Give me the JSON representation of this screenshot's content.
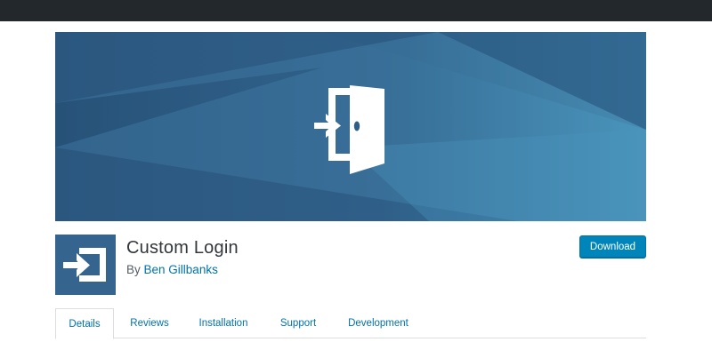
{
  "colors": {
    "topbar": "#23282d",
    "banner_dark": "#2e5c85",
    "banner_light": "#52a3c7",
    "accent": "#0085ba",
    "link": "#0073aa",
    "icon_bg": "#35658f"
  },
  "banner": {
    "icon": "door-enter-icon"
  },
  "plugin": {
    "icon": "login-arrow-icon",
    "title": "Custom Login",
    "by_prefix": "By",
    "author": "Ben Gillbanks"
  },
  "actions": {
    "download_label": "Download"
  },
  "tabs": [
    {
      "label": "Details",
      "active": true
    },
    {
      "label": "Reviews",
      "active": false
    },
    {
      "label": "Installation",
      "active": false
    },
    {
      "label": "Support",
      "active": false
    },
    {
      "label": "Development",
      "active": false
    }
  ]
}
